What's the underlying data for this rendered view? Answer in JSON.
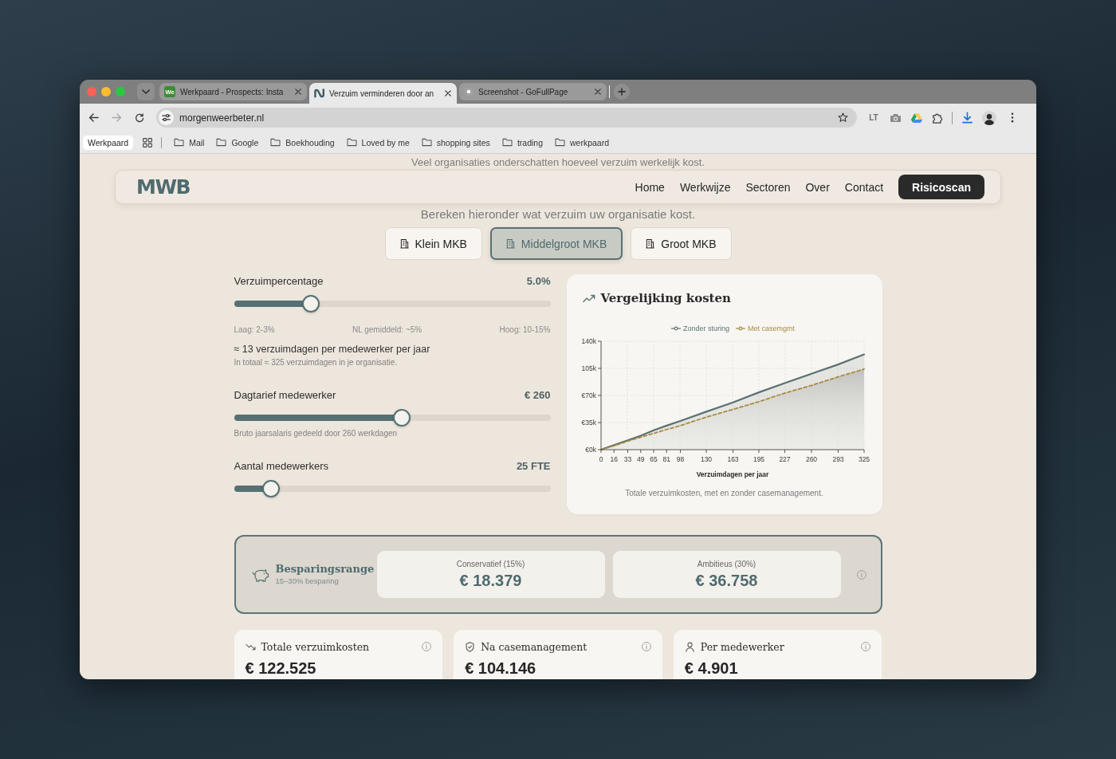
{
  "browser": {
    "tabs": [
      {
        "kind": "badge",
        "badge": "We",
        "title": "Werkpaard - Prospects: Insta",
        "selected": false
      },
      {
        "kind": "logo",
        "title": "Verzuim verminderen door an",
        "selected": true
      },
      {
        "kind": "dot",
        "title": "Screenshot - GoFullPage",
        "selected": false
      }
    ],
    "nav_buttons": [
      {
        "kind": "back",
        "disabled": false
      },
      {
        "kind": "forward",
        "disabled": true
      },
      {
        "kind": "reload",
        "disabled": false
      }
    ],
    "url": "morgenweerbeter.nl",
    "extensions": [
      {
        "kind": "text",
        "label": "LT"
      },
      {
        "kind": "camera"
      },
      {
        "kind": "drive"
      },
      {
        "kind": "puzzle"
      }
    ],
    "tab_group": "Werkpaard",
    "bookmarks": [
      {
        "label": "Mail"
      },
      {
        "label": "Google"
      },
      {
        "label": "Boekhouding"
      },
      {
        "label": "Loved by me"
      },
      {
        "label": "shopping sites"
      },
      {
        "label": "trading"
      },
      {
        "label": "werkpaard"
      }
    ]
  },
  "page": {
    "intro": "Veel organisaties onderschatten hoeveel verzuim werkelijk kost.",
    "header": {
      "logo": "MWB",
      "nav": [
        {
          "label": "Home"
        },
        {
          "label": "Werkwijze"
        },
        {
          "label": "Sectoren"
        },
        {
          "label": "Over"
        },
        {
          "label": "Contact"
        }
      ],
      "cta": "Risicoscan"
    },
    "subtitle": "Bereken hieronder wat verzuim uw organisatie kost.",
    "company_sizes": [
      {
        "label": "Klein MKB",
        "selected": false
      },
      {
        "label": "Middelgroot MKB",
        "selected": true
      },
      {
        "label": "Groot MKB",
        "selected": false
      }
    ],
    "sliders": [
      {
        "label": "Verzuimpercentage",
        "reading": "5.0%",
        "level": 0.244,
        "scale": [
          "Laag: 2-3%",
          "NL gemiddeld: ~5%",
          "Hoog: 10-15%"
        ],
        "summary": "≈ 13 verzuimdagen per medewerker per jaar",
        "note": "In totaal ≈ 325 verzuimdagen in je organisatie."
      },
      {
        "label": "Dagtarief medewerker",
        "reading": "€ 260",
        "level": 0.531,
        "note": "Bruto jaarsalaris gedeeld door 260 werkdagen"
      },
      {
        "label": "Aantal medewerkers",
        "reading": "25 FTE",
        "level": 0.118
      }
    ],
    "chart_card": {
      "chart_data": {
        "type": "area",
        "title": "Vergelijking kosten",
        "xlabel": "Verzuimdagen per jaar",
        "x": [
          0,
          16,
          33,
          49,
          65,
          81,
          98,
          130,
          163,
          195,
          227,
          260,
          293,
          325
        ],
        "series": [
          {
            "name": "Zonder sturing",
            "color": "#5b7174",
            "values": [
              0,
              6000,
              12000,
              18000,
              25000,
              31000,
              37000,
              49000,
              61000,
              74000,
              86000,
              98000,
              110000,
              123000
            ]
          },
          {
            "name": "Met casemgmt",
            "color": "#a68a3e",
            "values": [
              0,
              5000,
              11000,
              16000,
              21000,
              26000,
              31000,
              42000,
              52000,
              62000,
              73000,
              83000,
              94000,
              104000
            ]
          }
        ],
        "xlim": [
          0,
          325
        ],
        "ylim": [
          0,
          140000
        ],
        "xticks": [
          0,
          16,
          33,
          49,
          65,
          81,
          98,
          130,
          163,
          195,
          227,
          260,
          293,
          325
        ],
        "yticks": [
          {
            "value": 0,
            "label": "€0k"
          },
          {
            "value": 35000,
            "label": "€35k"
          },
          {
            "value": 70000,
            "label": "€70k"
          },
          {
            "value": 105000,
            "label": "105k"
          },
          {
            "value": 140000,
            "label": "140k"
          }
        ],
        "grid": true,
        "legend": "top"
      },
      "caption": "Totale verzuimkosten, met en zonder casemanagement."
    },
    "savings": {
      "title": "Besparingsrange",
      "subtitle": "15–30% besparing",
      "options": [
        {
          "label": "Conservatief (15%)",
          "value": "€ 18.379"
        },
        {
          "label": "Ambitieus (30%)",
          "value": "€ 36.758"
        }
      ]
    },
    "stats": [
      {
        "kind": "down",
        "title": "Totale verzuimkosten",
        "value": "€ 122.525"
      },
      {
        "kind": "shield",
        "title": "Na casemanagement",
        "value": "€ 104.146"
      },
      {
        "kind": "person",
        "title": "Per medewerker",
        "value": "€ 4.901"
      }
    ]
  }
}
